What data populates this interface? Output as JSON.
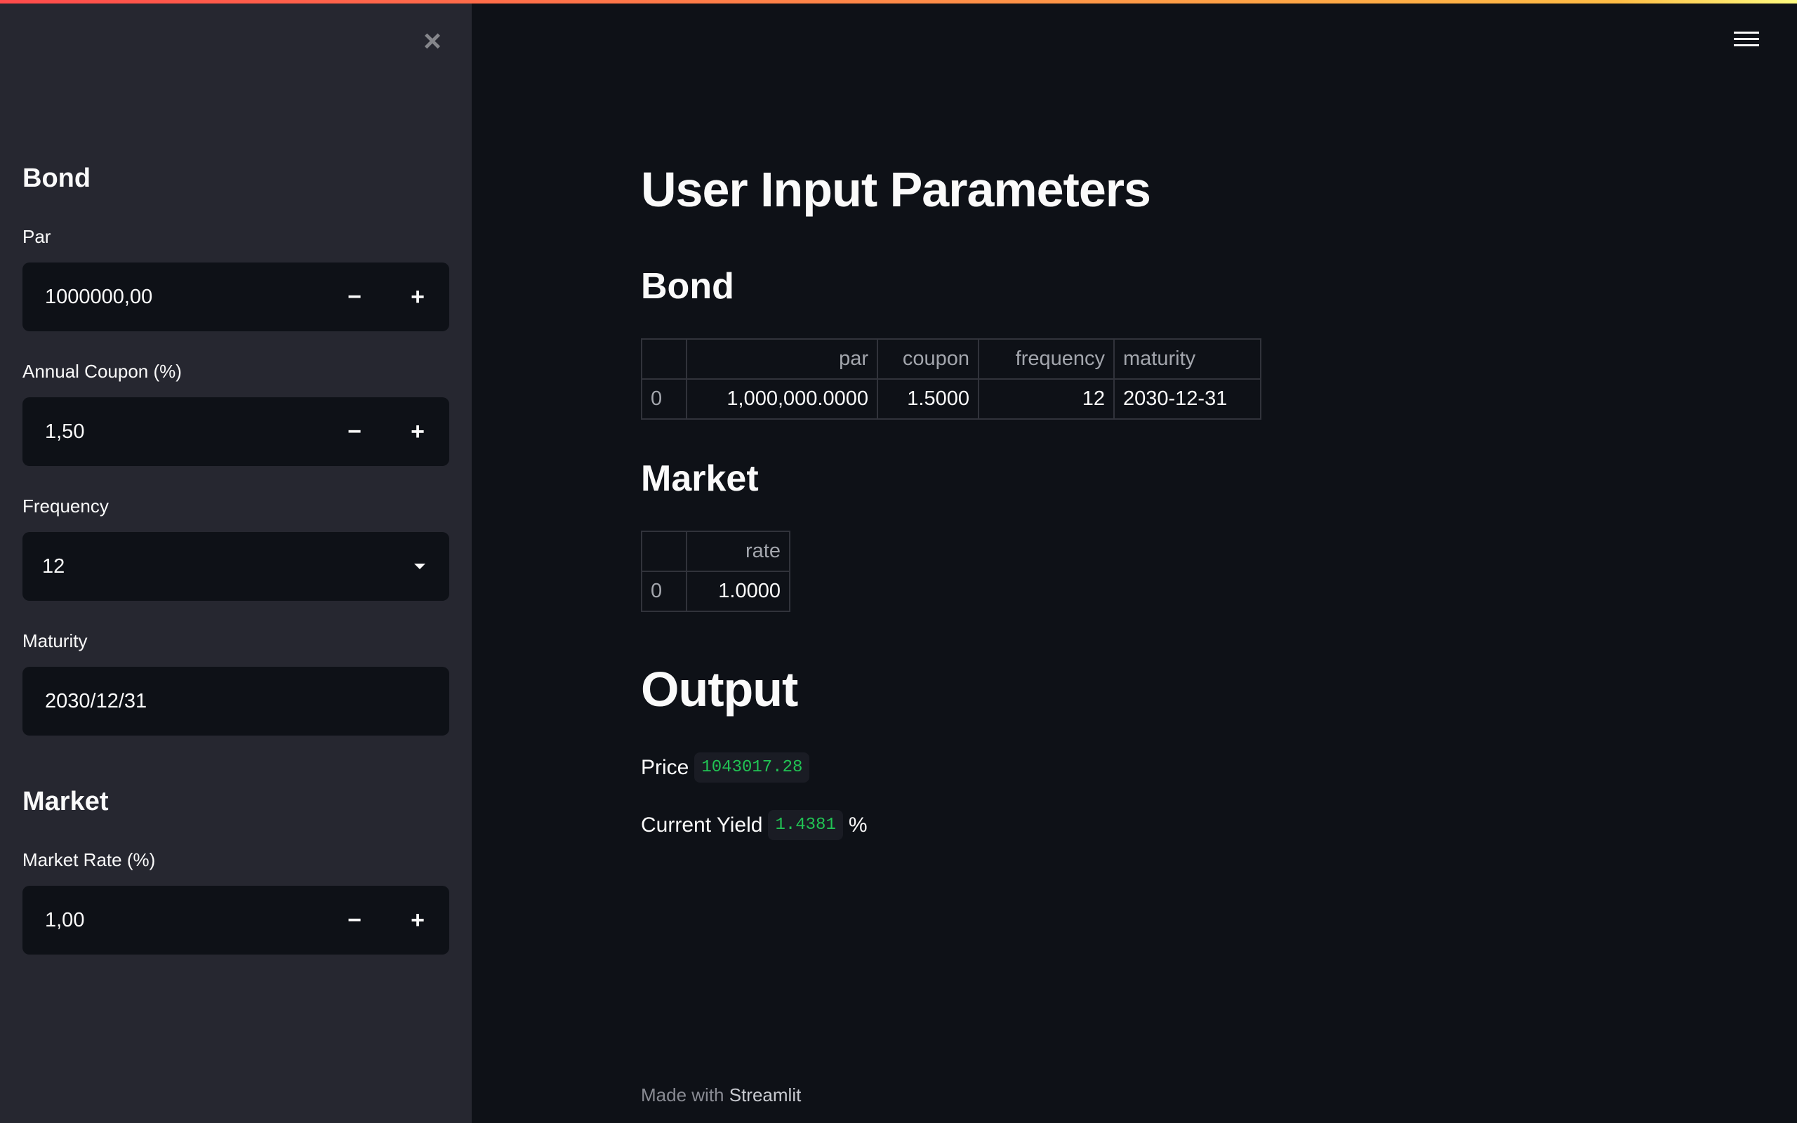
{
  "sidebar": {
    "bond_heading": "Bond",
    "par": {
      "label": "Par",
      "value": "1000000,00"
    },
    "coupon": {
      "label": "Annual Coupon (%)",
      "value": "1,50"
    },
    "frequency": {
      "label": "Frequency",
      "value": "12"
    },
    "maturity": {
      "label": "Maturity",
      "value": "2030/12/31"
    },
    "market_heading": "Market",
    "market_rate": {
      "label": "Market Rate (%)",
      "value": "1,00"
    },
    "minus": "−",
    "plus": "+",
    "close": "×"
  },
  "main": {
    "title": "User Input Parameters",
    "bond_heading": "Bond",
    "bond_table": {
      "headers": [
        "",
        "par",
        "coupon",
        "frequency",
        "maturity"
      ],
      "row": [
        "0",
        "1,000,000.0000",
        "1.5000",
        "12",
        "2030-12-31"
      ]
    },
    "market_heading": "Market",
    "market_table": {
      "headers": [
        "",
        "rate"
      ],
      "row": [
        "0",
        "1.0000"
      ]
    },
    "output_heading": "Output",
    "price_label": "Price",
    "price_value": "1043017.28",
    "yield_label": "Current Yield",
    "yield_value": "1.4381",
    "yield_unit": "%"
  },
  "footer": {
    "prefix": "Made with",
    "brand": "Streamlit"
  },
  "colors": {
    "accent": "#ff4b4b",
    "code_green": "#21c354",
    "sidebar_bg": "#262730",
    "main_bg": "#0e1117"
  }
}
